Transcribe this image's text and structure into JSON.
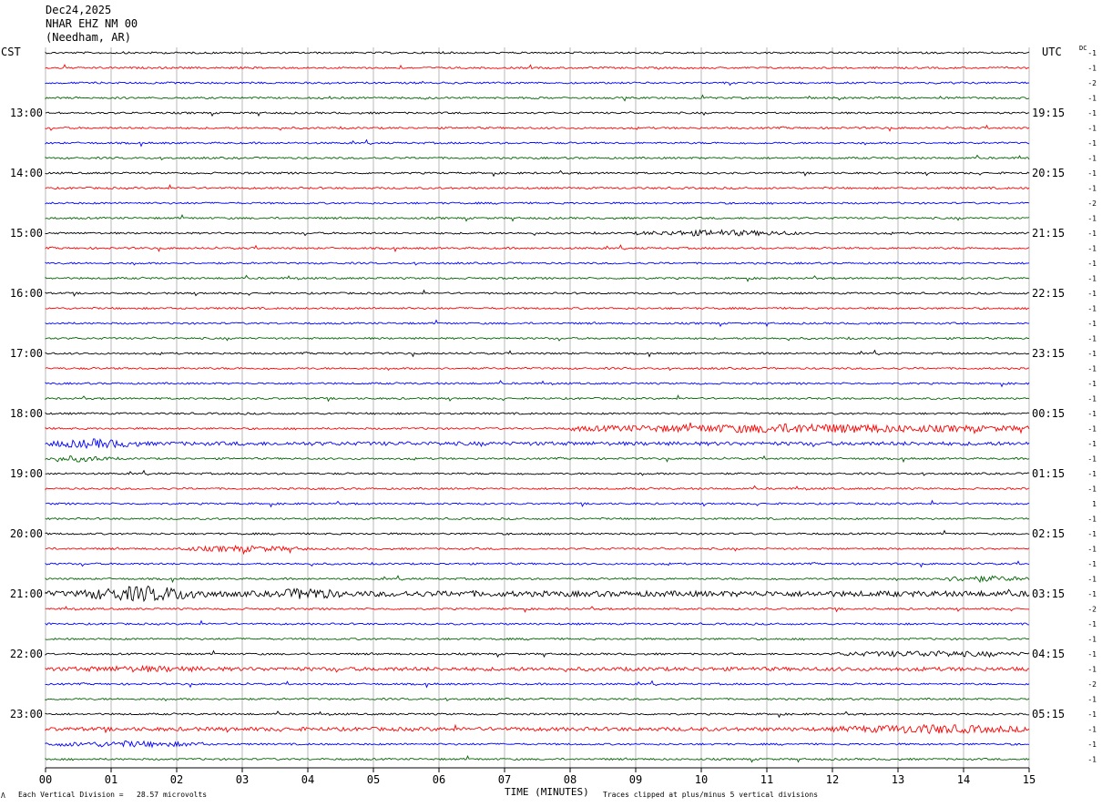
{
  "header": {
    "date": "Dec24,2025",
    "station": "NHAR EHZ NM 00",
    "location": "(Needham, AR)"
  },
  "labels": {
    "left_timezone": "CST",
    "right_timezone": "UTC",
    "dc_label": "DC",
    "corner_mark": "Λ"
  },
  "footer": {
    "vertical_division": "Each Vertical Division =   28.57 microvolts",
    "time_axis_title": "TIME (MINUTES)",
    "clip_note": "Traces clipped at plus/minus 5 vertical divisions"
  },
  "colors": {
    "trace_cycle": [
      "#000000",
      "#ff0000",
      "#0000ff",
      "#006400"
    ],
    "grid": "#888888"
  },
  "chart_data": {
    "type": "line",
    "title": "",
    "x_range": [
      0,
      15
    ],
    "x_ticks": [
      "00",
      "01",
      "02",
      "03",
      "04",
      "05",
      "06",
      "07",
      "08",
      "09",
      "10",
      "11",
      "12",
      "13",
      "14",
      "15"
    ],
    "xlabel": "TIME (MINUTES)",
    "rows": 48,
    "minutes_per_row": 15,
    "left_time_labels": [
      "13:00",
      "14:00",
      "15:00",
      "16:00",
      "17:00",
      "18:00",
      "19:00",
      "20:00",
      "21:00",
      "22:00",
      "23:00"
    ],
    "right_time_labels": [
      "19:15",
      "20:15",
      "21:15",
      "22:15",
      "23:15",
      "00:15",
      "01:15",
      "02:15",
      "03:15",
      "04:15",
      "05:15"
    ],
    "dc_offsets": [
      "-1",
      "-1",
      "-2",
      "-1",
      "-1",
      "-1",
      "-1",
      "-1",
      "-1",
      "-1",
      "-2",
      "-1",
      "-1",
      "-1",
      "-1",
      "-1",
      "-1",
      "-1",
      "-1",
      "-1",
      "-1",
      "-1",
      "-1",
      "-1",
      "-1",
      "-1",
      "-1",
      "-1",
      "-1",
      "-1",
      "1",
      "-1",
      "-1",
      "-1",
      "-1",
      "-1",
      "-1",
      "-2",
      "-1",
      "-1",
      "-1",
      "-1",
      "-2",
      "-1",
      "-1",
      "-1",
      "-1",
      "-1"
    ],
    "trace_amplitude": [
      1,
      1,
      1,
      1,
      1,
      1,
      1,
      1,
      1,
      1,
      1,
      1,
      1,
      1,
      1,
      1,
      1,
      1,
      1,
      1,
      1,
      1,
      1,
      1,
      1,
      1,
      2,
      1,
      1,
      1,
      1,
      1,
      1,
      1,
      1,
      1,
      3,
      1,
      1,
      1,
      1,
      2,
      1,
      1,
      1,
      2,
      1,
      1
    ],
    "events": [
      {
        "row": 12,
        "start_min": 9.0,
        "end_min": 11.5,
        "amp": 2
      },
      {
        "row": 25,
        "start_min": 8.0,
        "end_min": 15.0,
        "amp": 3
      },
      {
        "row": 26,
        "start_min": 0.0,
        "end_min": 1.5,
        "amp": 3
      },
      {
        "row": 27,
        "start_min": 0.0,
        "end_min": 1.0,
        "amp": 2
      },
      {
        "row": 33,
        "start_min": 2.0,
        "end_min": 4.0,
        "amp": 2
      },
      {
        "row": 35,
        "start_min": 13.5,
        "end_min": 15.0,
        "amp": 2
      },
      {
        "row": 36,
        "start_min": 0.5,
        "end_min": 2.5,
        "amp": 5
      },
      {
        "row": 36,
        "start_min": 3.5,
        "end_min": 4.5,
        "amp": 4
      },
      {
        "row": 36,
        "start_min": 6.2,
        "end_min": 6.8,
        "amp": 2
      },
      {
        "row": 40,
        "start_min": 12.0,
        "end_min": 15.0,
        "amp": 2
      },
      {
        "row": 41,
        "start_min": 0.0,
        "end_min": 3.0,
        "amp": 2
      },
      {
        "row": 45,
        "start_min": 12.0,
        "end_min": 15.0,
        "amp": 3
      },
      {
        "row": 46,
        "start_min": 0.0,
        "end_min": 2.5,
        "amp": 2
      }
    ]
  }
}
